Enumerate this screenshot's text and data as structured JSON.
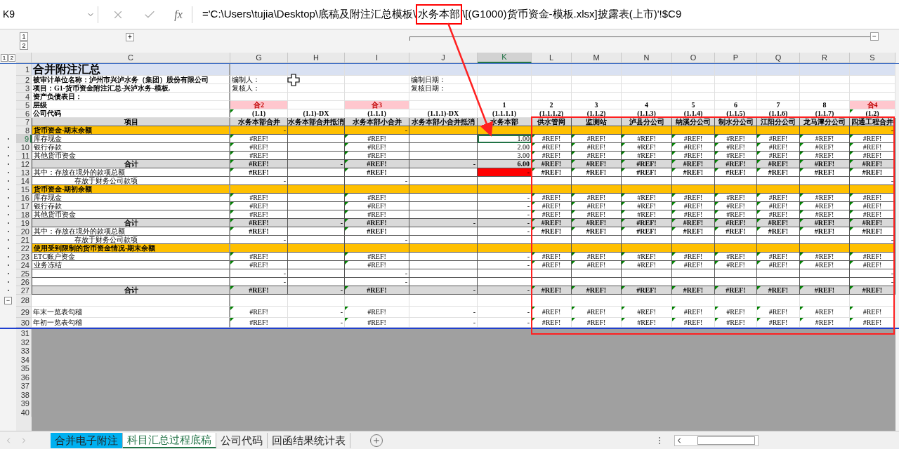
{
  "name_box": "K9",
  "function_label": "fx",
  "formula": [
    {
      "text": "='C:\\Users\\tujia\\Desktop\\底稿及附注汇总模板\\",
      "boxed": false
    },
    {
      "text": "水务本部",
      "boxed": true
    },
    {
      "text": "\\[(G1000)货币资金-模板.xlsx]披露表(上市)'!$C9",
      "boxed": false
    }
  ],
  "outline": {
    "column_levels": [
      "1",
      "2"
    ],
    "row_levels": [
      "1",
      "2"
    ],
    "expand": "+",
    "collapse": "−"
  },
  "columns": [
    {
      "letter": "C",
      "selected": false
    },
    {
      "letter": "G",
      "selected": false
    },
    {
      "letter": "H",
      "selected": false
    },
    {
      "letter": "I",
      "selected": false
    },
    {
      "letter": "J",
      "selected": false
    },
    {
      "letter": "K",
      "selected": true
    },
    {
      "letter": "L",
      "selected": false
    },
    {
      "letter": "M",
      "selected": false
    },
    {
      "letter": "N",
      "selected": false
    },
    {
      "letter": "O",
      "selected": false
    },
    {
      "letter": "P",
      "selected": false
    },
    {
      "letter": "Q",
      "selected": false
    },
    {
      "letter": "R",
      "selected": false
    },
    {
      "letter": "S",
      "selected": false
    }
  ],
  "rows": [
    {
      "number": "1",
      "kind": "title",
      "grouped": false,
      "selected": false,
      "label": "合并附注汇总",
      "cells": [
        null,
        null,
        null,
        null,
        null,
        null,
        null,
        null,
        null,
        null,
        null,
        null,
        null
      ]
    },
    {
      "number": "2",
      "kind": "info",
      "grouped": false,
      "selected": false,
      "label": "被审计单位名称：泸州市兴泸水务（集团）股份有限公司",
      "cells": [
        {
          "text": "编制人：",
          "kind": "text",
          "flag": false
        },
        null,
        null,
        {
          "text": "编制日期：",
          "kind": "text",
          "flag": false
        },
        null,
        null,
        null,
        null,
        null,
        null,
        null,
        null,
        null
      ]
    },
    {
      "number": "3",
      "kind": "info",
      "grouped": false,
      "selected": false,
      "label": "项目：G1-货币资金附注汇总-兴泸水务-模板.",
      "cells": [
        {
          "text": "复核人：",
          "kind": "text",
          "flag": false
        },
        null,
        null,
        {
          "text": "复核日期：",
          "kind": "text",
          "flag": false
        },
        null,
        null,
        null,
        null,
        null,
        null,
        null,
        null,
        null
      ]
    },
    {
      "number": "4",
      "kind": "info",
      "grouped": false,
      "selected": false,
      "label": "资产负债表日：",
      "cells": [
        null,
        null,
        null,
        null,
        null,
        null,
        null,
        null,
        null,
        null,
        null,
        null,
        null
      ]
    },
    {
      "number": "5",
      "kind": "info",
      "grouped": false,
      "selected": false,
      "label": "层级",
      "cells": [
        {
          "text": "合2",
          "kind": "level",
          "flag": false,
          "color": "#ffc7ce"
        },
        null,
        {
          "text": "合3",
          "kind": "level",
          "flag": false,
          "color": "#ffc7ce"
        },
        null,
        {
          "text": "1",
          "kind": "level",
          "flag": false
        },
        {
          "text": "2",
          "kind": "level",
          "flag": false
        },
        {
          "text": "3",
          "kind": "level",
          "flag": false
        },
        {
          "text": "4",
          "kind": "level",
          "flag": false
        },
        {
          "text": "5",
          "kind": "level",
          "flag": false
        },
        {
          "text": "6",
          "kind": "level",
          "flag": false
        },
        {
          "text": "7",
          "kind": "level",
          "flag": false
        },
        {
          "text": "8",
          "kind": "level",
          "flag": false
        },
        {
          "text": "合4",
          "kind": "level",
          "flag": false,
          "color": "#ffc7ce"
        }
      ]
    },
    {
      "number": "6",
      "kind": "info",
      "grouped": false,
      "selected": false,
      "label": "公司代码",
      "cells": [
        {
          "text": "(1.1)",
          "kind": "level",
          "flag": true
        },
        {
          "text": "(1.1)-DX",
          "kind": "level",
          "flag": false
        },
        {
          "text": "(1.1.1)",
          "kind": "level",
          "flag": false
        },
        {
          "text": "(1.1.1)-DX",
          "kind": "level",
          "flag": false
        },
        {
          "text": "(1.1.1.1)",
          "kind": "level",
          "flag": false
        },
        {
          "text": "(1.1.1.2)",
          "kind": "level",
          "flag": false
        },
        {
          "text": "(1.1.2)",
          "kind": "level",
          "flag": false
        },
        {
          "text": "(1.1.3)",
          "kind": "level",
          "flag": false
        },
        {
          "text": "(1.1.4)",
          "kind": "level",
          "flag": false
        },
        {
          "text": "(1.1.5)",
          "kind": "level",
          "flag": false
        },
        {
          "text": "(1.1.6)",
          "kind": "level",
          "flag": false
        },
        {
          "text": "(1.1.7)",
          "kind": "level",
          "flag": false
        },
        {
          "text": "(1.2)",
          "kind": "level",
          "flag": true
        }
      ]
    },
    {
      "number": "7",
      "kind": "heading",
      "grouped": false,
      "selected": false,
      "label": "项目",
      "cells": [
        {
          "text": "水务本部合并",
          "kind": "level",
          "flag": false
        },
        {
          "text": "水务本部合并抵消",
          "kind": "level",
          "flag": false
        },
        {
          "text": "水务本部小合并",
          "kind": "level",
          "flag": false
        },
        {
          "text": "水务本部小合并抵消",
          "kind": "level",
          "flag": false
        },
        {
          "text": "水务本部",
          "kind": "level",
          "flag": false
        },
        {
          "text": "供水管网",
          "kind": "level",
          "flag": false
        },
        {
          "text": "监测站",
          "kind": "level",
          "flag": false
        },
        {
          "text": "泸县分公司",
          "kind": "level",
          "flag": false
        },
        {
          "text": "纳溪分公司",
          "kind": "level",
          "flag": false
        },
        {
          "text": "制水分公司",
          "kind": "level",
          "flag": false
        },
        {
          "text": "江阳分公司",
          "kind": "level",
          "flag": false
        },
        {
          "text": "龙马潭分公司",
          "kind": "level",
          "flag": false
        },
        {
          "text": "四通工程合并",
          "kind": "level",
          "flag": false
        }
      ]
    },
    {
      "number": "8",
      "kind": "section",
      "grouped": false,
      "selected": false,
      "label": "货币资金-期末余额",
      "cells": [
        {
          "text": "-",
          "kind": "number",
          "flag": false
        },
        null,
        {
          "text": "-",
          "kind": "number",
          "flag": false
        },
        null,
        null,
        null,
        null,
        null,
        null,
        null,
        null,
        null,
        {
          "text": "-",
          "kind": "number",
          "flag": false
        }
      ]
    },
    {
      "number": "9",
      "kind": "item",
      "grouped": true,
      "selected": true,
      "label": "库存现金",
      "cells": [
        {
          "text": "#REF!",
          "kind": "error",
          "flag": true
        },
        null,
        {
          "text": "#REF!",
          "kind": "error",
          "flag": true
        },
        null,
        {
          "text": "1.00",
          "kind": "number",
          "flag": false
        },
        {
          "text": "#REF!",
          "kind": "error",
          "flag": true
        },
        {
          "text": "#REF!",
          "kind": "error",
          "flag": true
        },
        {
          "text": "#REF!",
          "kind": "error",
          "flag": true
        },
        {
          "text": "#REF!",
          "kind": "error",
          "flag": true
        },
        {
          "text": "#REF!",
          "kind": "error",
          "flag": true
        },
        {
          "text": "#REF!",
          "kind": "error",
          "flag": true
        },
        {
          "text": "#REF!",
          "kind": "error",
          "flag": true
        },
        {
          "text": "#REF!",
          "kind": "error",
          "flag": true
        }
      ]
    },
    {
      "number": "10",
      "kind": "item",
      "grouped": true,
      "selected": false,
      "label": "银行存款",
      "cells": [
        {
          "text": "#REF!",
          "kind": "error",
          "flag": true
        },
        null,
        {
          "text": "#REF!",
          "kind": "error",
          "flag": true
        },
        null,
        {
          "text": "2.00",
          "kind": "number",
          "flag": false
        },
        {
          "text": "#REF!",
          "kind": "error",
          "flag": true
        },
        {
          "text": "#REF!",
          "kind": "error",
          "flag": true
        },
        {
          "text": "#REF!",
          "kind": "error",
          "flag": true
        },
        {
          "text": "#REF!",
          "kind": "error",
          "flag": true
        },
        {
          "text": "#REF!",
          "kind": "error",
          "flag": true
        },
        {
          "text": "#REF!",
          "kind": "error",
          "flag": true
        },
        {
          "text": "#REF!",
          "kind": "error",
          "flag": true
        },
        {
          "text": "#REF!",
          "kind": "error",
          "flag": true
        }
      ]
    },
    {
      "number": "11",
      "kind": "item",
      "grouped": true,
      "selected": false,
      "label": "其他货币资金",
      "cells": [
        {
          "text": "#REF!",
          "kind": "error",
          "flag": true
        },
        null,
        {
          "text": "#REF!",
          "kind": "error",
          "flag": true
        },
        null,
        {
          "text": "3.00",
          "kind": "number",
          "flag": false
        },
        {
          "text": "#REF!",
          "kind": "error",
          "flag": true
        },
        {
          "text": "#REF!",
          "kind": "error",
          "flag": true
        },
        {
          "text": "#REF!",
          "kind": "error",
          "flag": true
        },
        {
          "text": "#REF!",
          "kind": "error",
          "flag": true
        },
        {
          "text": "#REF!",
          "kind": "error",
          "flag": true
        },
        {
          "text": "#REF!",
          "kind": "error",
          "flag": true
        },
        {
          "text": "#REF!",
          "kind": "error",
          "flag": true
        },
        {
          "text": "#REF!",
          "kind": "error",
          "flag": true
        }
      ]
    },
    {
      "number": "12",
      "kind": "total",
      "grouped": true,
      "selected": false,
      "label": "合计",
      "cells": [
        {
          "text": "#REF!",
          "kind": "error",
          "flag": true
        },
        {
          "text": "-",
          "kind": "number",
          "flag": false
        },
        {
          "text": "#REF!",
          "kind": "error",
          "flag": true
        },
        {
          "text": "-",
          "kind": "number",
          "flag": false
        },
        {
          "text": "6.00",
          "kind": "number",
          "flag": false
        },
        {
          "text": "#REF!",
          "kind": "error",
          "flag": true
        },
        {
          "text": "#REF!",
          "kind": "error",
          "flag": true
        },
        {
          "text": "#REF!",
          "kind": "error",
          "flag": true
        },
        {
          "text": "#REF!",
          "kind": "error",
          "flag": true
        },
        {
          "text": "#REF!",
          "kind": "error",
          "flag": true
        },
        {
          "text": "#REF!",
          "kind": "error",
          "flag": true
        },
        {
          "text": "#REF!",
          "kind": "error",
          "flag": true
        },
        {
          "text": "#REF!",
          "kind": "error",
          "flag": true
        }
      ]
    },
    {
      "number": "13",
      "kind": "strong_item",
      "grouped": true,
      "selected": false,
      "label": "其中：存放在境外的款项总额",
      "cells": [
        {
          "text": "#REF!",
          "kind": "error",
          "flag": true
        },
        null,
        {
          "text": "#REF!",
          "kind": "error",
          "flag": true
        },
        null,
        {
          "text": "-",
          "kind": "number",
          "flag": false,
          "color": "#ff0000"
        },
        {
          "text": "#REF!",
          "kind": "error",
          "flag": true
        },
        {
          "text": "#REF!",
          "kind": "error",
          "flag": true
        },
        {
          "text": "#REF!",
          "kind": "error",
          "flag": true
        },
        {
          "text": "#REF!",
          "kind": "error",
          "flag": true
        },
        {
          "text": "#REF!",
          "kind": "error",
          "flag": true
        },
        {
          "text": "#REF!",
          "kind": "error",
          "flag": true
        },
        {
          "text": "#REF!",
          "kind": "error",
          "flag": true
        },
        {
          "text": "#REF!",
          "kind": "error",
          "flag": true
        }
      ]
    },
    {
      "number": "14",
      "kind": "indent_item",
      "grouped": true,
      "selected": false,
      "label": "存放于财务公司款项",
      "cells": [
        {
          "text": "-",
          "kind": "number",
          "flag": false
        },
        null,
        {
          "text": "-",
          "kind": "number",
          "flag": false
        },
        null,
        null,
        null,
        null,
        null,
        null,
        null,
        null,
        null,
        {
          "text": "-",
          "kind": "number",
          "flag": false
        }
      ]
    },
    {
      "number": "15",
      "kind": "section",
      "grouped": true,
      "selected": false,
      "label": "货币资金-期初余额",
      "cells": [
        null,
        null,
        null,
        null,
        null,
        null,
        null,
        null,
        null,
        null,
        null,
        null,
        null
      ]
    },
    {
      "number": "16",
      "kind": "item",
      "grouped": true,
      "selected": false,
      "label": "库存现金",
      "cells": [
        {
          "text": "#REF!",
          "kind": "error",
          "flag": true
        },
        null,
        {
          "text": "#REF!",
          "kind": "error",
          "flag": true
        },
        null,
        {
          "text": "-",
          "kind": "number",
          "flag": false
        },
        {
          "text": "#REF!",
          "kind": "error",
          "flag": true
        },
        {
          "text": "#REF!",
          "kind": "error",
          "flag": true
        },
        {
          "text": "#REF!",
          "kind": "error",
          "flag": true
        },
        {
          "text": "#REF!",
          "kind": "error",
          "flag": true
        },
        {
          "text": "#REF!",
          "kind": "error",
          "flag": true
        },
        {
          "text": "#REF!",
          "kind": "error",
          "flag": true
        },
        {
          "text": "#REF!",
          "kind": "error",
          "flag": true
        },
        {
          "text": "#REF!",
          "kind": "error",
          "flag": true
        }
      ]
    },
    {
      "number": "17",
      "kind": "item",
      "grouped": true,
      "selected": false,
      "label": "银行存款",
      "cells": [
        {
          "text": "#REF!",
          "kind": "error",
          "flag": true
        },
        null,
        {
          "text": "#REF!",
          "kind": "error",
          "flag": true
        },
        null,
        {
          "text": "-",
          "kind": "number",
          "flag": false
        },
        {
          "text": "#REF!",
          "kind": "error",
          "flag": true
        },
        {
          "text": "#REF!",
          "kind": "error",
          "flag": true
        },
        {
          "text": "#REF!",
          "kind": "error",
          "flag": true
        },
        {
          "text": "#REF!",
          "kind": "error",
          "flag": true
        },
        {
          "text": "#REF!",
          "kind": "error",
          "flag": true
        },
        {
          "text": "#REF!",
          "kind": "error",
          "flag": true
        },
        {
          "text": "#REF!",
          "kind": "error",
          "flag": true
        },
        {
          "text": "#REF!",
          "kind": "error",
          "flag": true
        }
      ]
    },
    {
      "number": "18",
      "kind": "item",
      "grouped": true,
      "selected": false,
      "label": "其他货币资金",
      "cells": [
        {
          "text": "#REF!",
          "kind": "error",
          "flag": true
        },
        null,
        {
          "text": "#REF!",
          "kind": "error",
          "flag": true
        },
        null,
        {
          "text": "-",
          "kind": "number",
          "flag": false
        },
        {
          "text": "#REF!",
          "kind": "error",
          "flag": true
        },
        {
          "text": "#REF!",
          "kind": "error",
          "flag": true
        },
        {
          "text": "#REF!",
          "kind": "error",
          "flag": true
        },
        {
          "text": "#REF!",
          "kind": "error",
          "flag": true
        },
        {
          "text": "#REF!",
          "kind": "error",
          "flag": true
        },
        {
          "text": "#REF!",
          "kind": "error",
          "flag": true
        },
        {
          "text": "#REF!",
          "kind": "error",
          "flag": true
        },
        {
          "text": "#REF!",
          "kind": "error",
          "flag": true
        }
      ]
    },
    {
      "number": "19",
      "kind": "total",
      "grouped": true,
      "selected": false,
      "label": "合计",
      "cells": [
        {
          "text": "#REF!",
          "kind": "error",
          "flag": true
        },
        {
          "text": "-",
          "kind": "number",
          "flag": false
        },
        {
          "text": "#REF!",
          "kind": "error",
          "flag": true
        },
        {
          "text": "-",
          "kind": "number",
          "flag": false
        },
        {
          "text": "-",
          "kind": "number",
          "flag": false
        },
        {
          "text": "#REF!",
          "kind": "error",
          "flag": true
        },
        {
          "text": "#REF!",
          "kind": "error",
          "flag": true
        },
        {
          "text": "#REF!",
          "kind": "error",
          "flag": true
        },
        {
          "text": "#REF!",
          "kind": "error",
          "flag": true
        },
        {
          "text": "#REF!",
          "kind": "error",
          "flag": true
        },
        {
          "text": "#REF!",
          "kind": "error",
          "flag": true
        },
        {
          "text": "#REF!",
          "kind": "error",
          "flag": true
        },
        {
          "text": "#REF!",
          "kind": "error",
          "flag": true
        }
      ]
    },
    {
      "number": "20",
      "kind": "strong_item",
      "grouped": true,
      "selected": false,
      "label": "其中：存放在境外的款项总额",
      "cells": [
        {
          "text": "#REF!",
          "kind": "error",
          "flag": true
        },
        null,
        {
          "text": "#REF!",
          "kind": "error",
          "flag": true
        },
        null,
        {
          "text": "-",
          "kind": "number",
          "flag": false
        },
        {
          "text": "#REF!",
          "kind": "error",
          "flag": true
        },
        {
          "text": "#REF!",
          "kind": "error",
          "flag": true
        },
        {
          "text": "#REF!",
          "kind": "error",
          "flag": true
        },
        {
          "text": "#REF!",
          "kind": "error",
          "flag": true
        },
        {
          "text": "#REF!",
          "kind": "error",
          "flag": true
        },
        {
          "text": "#REF!",
          "kind": "error",
          "flag": true
        },
        {
          "text": "#REF!",
          "kind": "error",
          "flag": true
        },
        {
          "text": "#REF!",
          "kind": "error",
          "flag": true
        }
      ]
    },
    {
      "number": "21",
      "kind": "indent_item",
      "grouped": true,
      "selected": false,
      "label": "存放于财务公司款项",
      "cells": [
        {
          "text": "-",
          "kind": "number",
          "flag": false
        },
        null,
        {
          "text": "-",
          "kind": "number",
          "flag": false
        },
        null,
        null,
        null,
        null,
        null,
        null,
        null,
        null,
        null,
        {
          "text": "-",
          "kind": "number",
          "flag": false
        }
      ]
    },
    {
      "number": "22",
      "kind": "section",
      "grouped": true,
      "selected": false,
      "label": "使用受到限制的货币资金情况-期末余额",
      "cells": [
        null,
        null,
        null,
        null,
        null,
        null,
        null,
        null,
        null,
        null,
        null,
        null,
        null
      ]
    },
    {
      "number": "23",
      "kind": "item",
      "grouped": true,
      "selected": false,
      "label": "ETC账户资金",
      "cells": [
        {
          "text": "#REF!",
          "kind": "error",
          "flag": true
        },
        null,
        {
          "text": "#REF!",
          "kind": "error",
          "flag": true
        },
        null,
        {
          "text": "-",
          "kind": "number",
          "flag": false
        },
        {
          "text": "#REF!",
          "kind": "error",
          "flag": true
        },
        {
          "text": "#REF!",
          "kind": "error",
          "flag": true
        },
        {
          "text": "#REF!",
          "kind": "error",
          "flag": true
        },
        {
          "text": "#REF!",
          "kind": "error",
          "flag": true
        },
        {
          "text": "#REF!",
          "kind": "error",
          "flag": true
        },
        {
          "text": "#REF!",
          "kind": "error",
          "flag": true
        },
        {
          "text": "#REF!",
          "kind": "error",
          "flag": true
        },
        {
          "text": "#REF!",
          "kind": "error",
          "flag": true
        }
      ]
    },
    {
      "number": "24",
      "kind": "item",
      "grouped": true,
      "selected": false,
      "label": "业务冻结",
      "cells": [
        {
          "text": "#REF!",
          "kind": "error",
          "flag": true
        },
        null,
        {
          "text": "#REF!",
          "kind": "error",
          "flag": true
        },
        null,
        {
          "text": "-",
          "kind": "number",
          "flag": false
        },
        {
          "text": "#REF!",
          "kind": "error",
          "flag": true
        },
        {
          "text": "#REF!",
          "kind": "error",
          "flag": true
        },
        {
          "text": "#REF!",
          "kind": "error",
          "flag": true
        },
        {
          "text": "#REF!",
          "kind": "error",
          "flag": true
        },
        {
          "text": "#REF!",
          "kind": "error",
          "flag": true
        },
        {
          "text": "#REF!",
          "kind": "error",
          "flag": true
        },
        {
          "text": "#REF!",
          "kind": "error",
          "flag": true
        },
        {
          "text": "#REF!",
          "kind": "error",
          "flag": true
        }
      ]
    },
    {
      "number": "25",
      "kind": "item",
      "grouped": true,
      "selected": false,
      "cells": [
        {
          "text": "-",
          "kind": "number",
          "flag": false
        },
        null,
        {
          "text": "-",
          "kind": "number",
          "flag": false
        },
        null,
        null,
        null,
        null,
        null,
        null,
        null,
        null,
        null,
        {
          "text": "-",
          "kind": "number",
          "flag": false
        }
      ]
    },
    {
      "number": "26",
      "kind": "item",
      "grouped": true,
      "selected": false,
      "cells": [
        {
          "text": "-",
          "kind": "number",
          "flag": false
        },
        null,
        {
          "text": "-",
          "kind": "number",
          "flag": false
        },
        null,
        null,
        null,
        null,
        null,
        null,
        null,
        null,
        null,
        {
          "text": "-",
          "kind": "number",
          "flag": false
        }
      ]
    },
    {
      "number": "27",
      "kind": "total",
      "grouped": true,
      "selected": false,
      "label": "合计",
      "cells": [
        {
          "text": "#REF!",
          "kind": "error",
          "flag": true
        },
        {
          "text": "-",
          "kind": "number",
          "flag": false
        },
        {
          "text": "#REF!",
          "kind": "error",
          "flag": true
        },
        {
          "text": "-",
          "kind": "number",
          "flag": false
        },
        {
          "text": "-",
          "kind": "number",
          "flag": false
        },
        {
          "text": "#REF!",
          "kind": "error",
          "flag": true
        },
        {
          "text": "#REF!",
          "kind": "error",
          "flag": true
        },
        {
          "text": "#REF!",
          "kind": "error",
          "flag": true
        },
        {
          "text": "#REF!",
          "kind": "error",
          "flag": true
        },
        {
          "text": "#REF!",
          "kind": "error",
          "flag": true
        },
        {
          "text": "#REF!",
          "kind": "error",
          "flag": true
        },
        {
          "text": "#REF!",
          "kind": "error",
          "flag": true
        },
        {
          "text": "#REF!",
          "kind": "error",
          "flag": true
        }
      ]
    },
    {
      "number": "28",
      "kind": "blank",
      "grouped": false,
      "selected": false,
      "toggle": "−",
      "cells": [
        null,
        null,
        null,
        null,
        null,
        null,
        null,
        null,
        null,
        null,
        null,
        null,
        null
      ]
    },
    {
      "number": "29",
      "kind": "check",
      "grouped": false,
      "selected": false,
      "label": "年末一览表勾稽",
      "cells": [
        {
          "text": "#REF!",
          "kind": "error",
          "flag": true
        },
        {
          "text": "-",
          "kind": "number",
          "flag": false
        },
        {
          "text": "#REF!",
          "kind": "error",
          "flag": true
        },
        {
          "text": "-",
          "kind": "number",
          "flag": false
        },
        {
          "text": "-",
          "kind": "number",
          "flag": false
        },
        {
          "text": "#REF!",
          "kind": "error",
          "flag": true
        },
        {
          "text": "#REF!",
          "kind": "error",
          "flag": true
        },
        {
          "text": "#REF!",
          "kind": "error",
          "flag": true
        },
        {
          "text": "#REF!",
          "kind": "error",
          "flag": true
        },
        {
          "text": "#REF!",
          "kind": "error",
          "flag": true
        },
        {
          "text": "#REF!",
          "kind": "error",
          "flag": true
        },
        {
          "text": "#REF!",
          "kind": "error",
          "flag": true
        },
        {
          "text": "#REF!",
          "kind": "error",
          "flag": true
        }
      ]
    },
    {
      "number": "30",
      "kind": "check",
      "grouped": false,
      "selected": false,
      "label": "年初一览表勾稽",
      "cells": [
        {
          "text": "#REF!",
          "kind": "error",
          "flag": true
        },
        {
          "text": "-",
          "kind": "number",
          "flag": false
        },
        {
          "text": "#REF!",
          "kind": "error",
          "flag": true
        },
        {
          "text": "-",
          "kind": "number",
          "flag": false
        },
        {
          "text": "-",
          "kind": "number",
          "flag": false
        },
        {
          "text": "#REF!",
          "kind": "error",
          "flag": true
        },
        {
          "text": "#REF!",
          "kind": "error",
          "flag": true
        },
        {
          "text": "#REF!",
          "kind": "error",
          "flag": true
        },
        {
          "text": "#REF!",
          "kind": "error",
          "flag": true
        },
        {
          "text": "#REF!",
          "kind": "error",
          "flag": true
        },
        {
          "text": "#REF!",
          "kind": "error",
          "flag": true
        },
        {
          "text": "#REF!",
          "kind": "error",
          "flag": true
        },
        {
          "text": "#REF!",
          "kind": "error",
          "flag": true
        }
      ]
    }
  ],
  "empty_rows": [
    "31",
    "32",
    "33",
    "34",
    "35",
    "36",
    "37",
    "38",
    "39",
    "40"
  ],
  "sheets": [
    {
      "name": "合并电子附注",
      "selected": false,
      "color": "#00b0f0"
    },
    {
      "name": "科目汇总过程底稿",
      "selected": true
    },
    {
      "name": "公司代码",
      "selected": false
    },
    {
      "name": "回函结果统计表",
      "selected": false
    }
  ]
}
